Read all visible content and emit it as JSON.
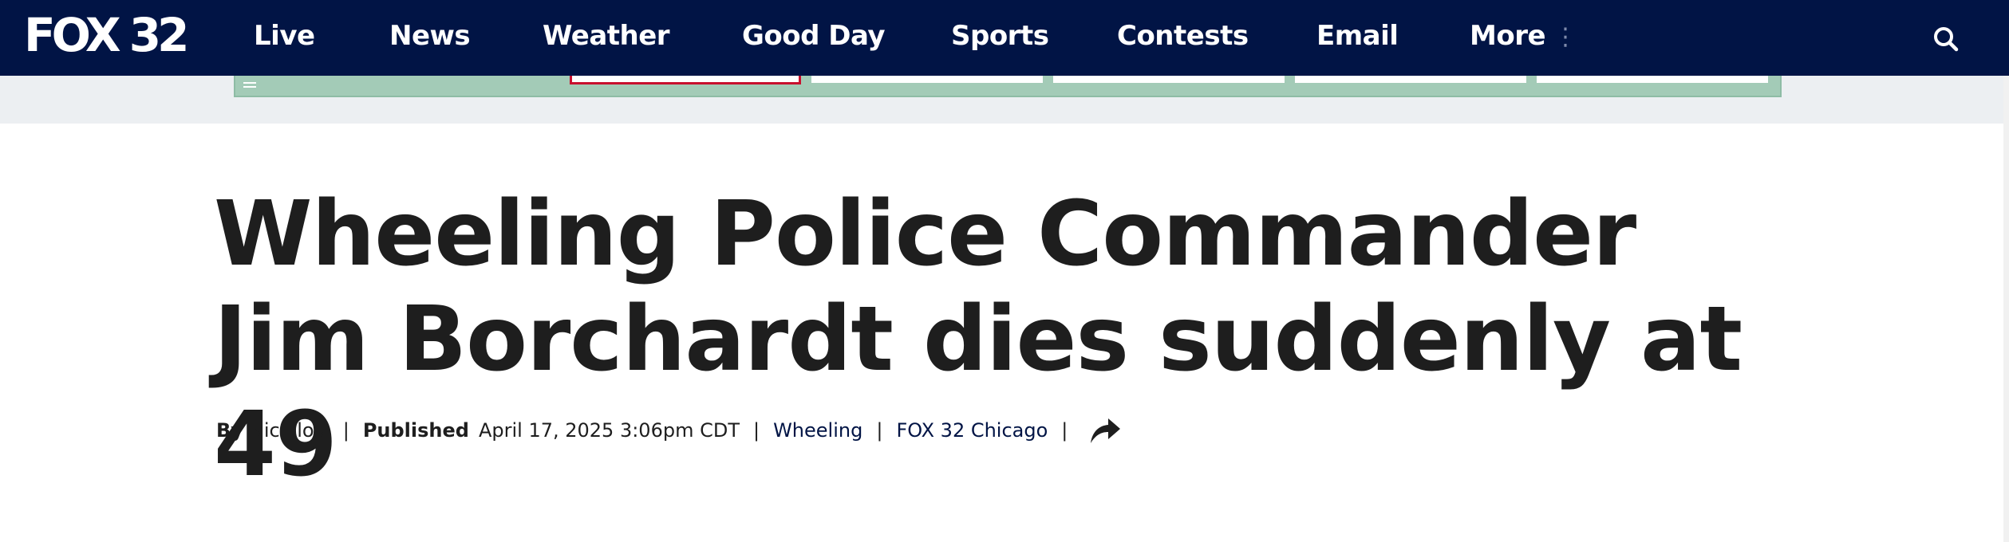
{
  "brand": {
    "logo_text": "FOX 32",
    "nav_bg_color": "#011445"
  },
  "nav": {
    "items": [
      {
        "label": "Live"
      },
      {
        "label": "News"
      },
      {
        "label": "Weather"
      },
      {
        "label": "Good Day"
      },
      {
        "label": "Sports"
      },
      {
        "label": "Contests"
      },
      {
        "label": "Email"
      },
      {
        "label": "More"
      }
    ],
    "more_dots": "⋮",
    "search_icon": "search-icon"
  },
  "article": {
    "headline": "Wheeling Police Commander Jim Borchardt dies suddenly at 49",
    "byline": {
      "by_label": "By",
      "author": "Nic Flosi",
      "published_label": "Published",
      "published_date": "April 17, 2025 3:06pm CDT",
      "location": "Wheeling",
      "source": "FOX 32 Chicago",
      "separator": "|",
      "share_icon": "share-icon"
    }
  },
  "colors": {
    "headline": "#1e1e1e",
    "link": "#011445",
    "ad_banner": "#a3cbb7",
    "ad_active_tab": "#c8102e"
  }
}
